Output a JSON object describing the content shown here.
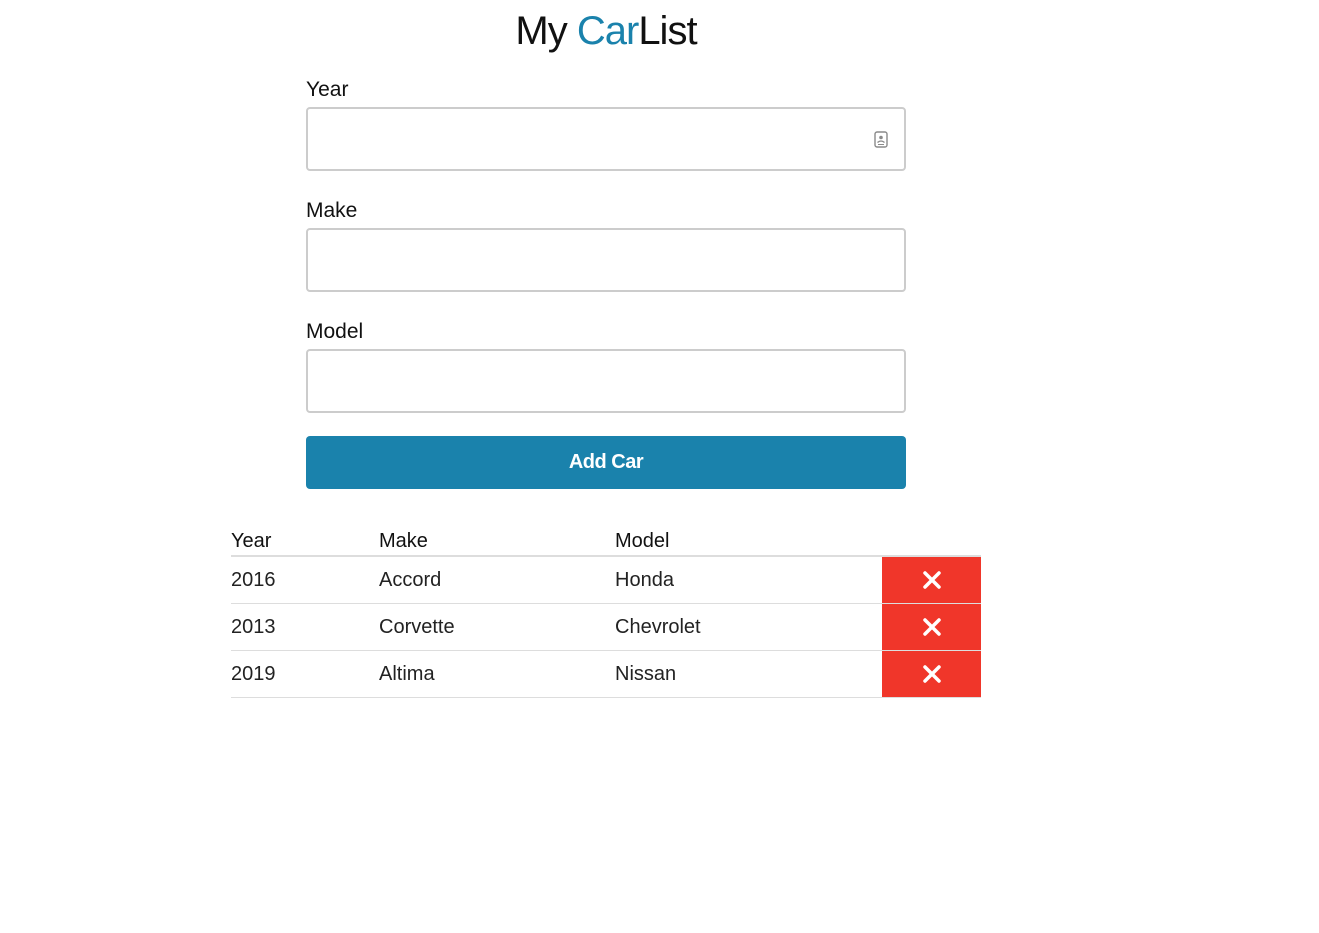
{
  "header": {
    "title_part1": "My ",
    "title_part2": "Car",
    "title_part3": "List",
    "accent_color": "#1a82ac"
  },
  "form": {
    "year": {
      "label": "Year",
      "value": "",
      "placeholder": ""
    },
    "make": {
      "label": "Make",
      "value": "",
      "placeholder": ""
    },
    "model": {
      "label": "Model",
      "value": "",
      "placeholder": ""
    },
    "submit_label": "Add Car",
    "year_field_icon": "contact-card-icon"
  },
  "table": {
    "columns": [
      "Year",
      "Make",
      "Model"
    ],
    "rows": [
      {
        "year": "2016",
        "make": "Accord",
        "model": "Honda"
      },
      {
        "year": "2013",
        "make": "Corvette",
        "model": "Chevrolet"
      },
      {
        "year": "2019",
        "make": "Altima",
        "model": "Nissan"
      }
    ],
    "delete_icon": "close-icon",
    "delete_color": "#f0362a"
  }
}
